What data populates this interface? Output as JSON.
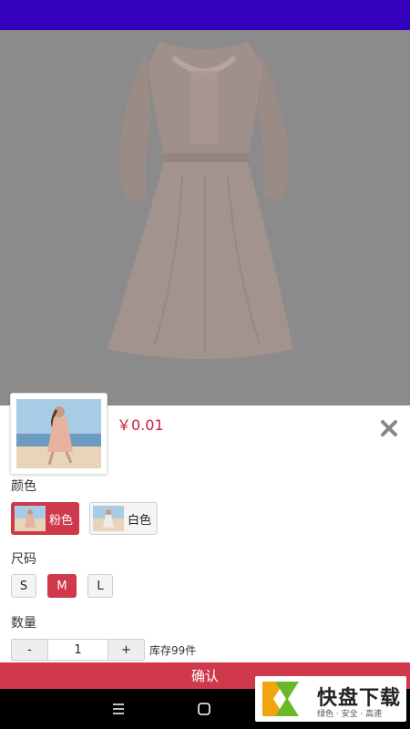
{
  "product": {
    "price": "￥0.01",
    "image_alt": "dress-photo"
  },
  "sections": {
    "color_label": "颜色",
    "size_label": "尺码",
    "quantity_label": "数量"
  },
  "colors": [
    {
      "label": "粉色",
      "selected": true
    },
    {
      "label": "白色",
      "selected": false
    }
  ],
  "sizes": [
    {
      "label": "S",
      "selected": false
    },
    {
      "label": "M",
      "selected": true
    },
    {
      "label": "L",
      "selected": false
    }
  ],
  "quantity": {
    "minus": "-",
    "value": "1",
    "plus": "+",
    "stock_text": "库存99件"
  },
  "confirm_label": "确认",
  "watermark": {
    "name": "快盘下载",
    "tagline": "绿色 · 安全 · 高速"
  },
  "theme": {
    "status_bar": "#3300bb",
    "accent": "#d0384b",
    "price": "#c8203a"
  },
  "icons": [
    "close-icon",
    "menu-icon",
    "home-icon",
    "back-icon",
    "dress-image"
  ]
}
